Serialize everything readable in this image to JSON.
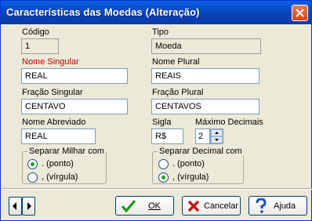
{
  "window": {
    "title": "Características das Moedas (Alteração)"
  },
  "fields": {
    "codigo": {
      "label": "Código",
      "value": "1"
    },
    "tipo": {
      "label": "Tipo",
      "value": "Moeda"
    },
    "nome_singular": {
      "label": "Nome Singular",
      "value": "REAL"
    },
    "nome_plural": {
      "label": "Nome Plural",
      "value": "REAIS"
    },
    "fracao_singular": {
      "label": "Fração Singular",
      "value": "CENTAVO"
    },
    "fracao_plural": {
      "label": "Fração Plural",
      "value": "CENTAVOS"
    },
    "nome_abreviado": {
      "label": "Nome Abreviado",
      "value": "REAL"
    },
    "sigla": {
      "label": "Sigla",
      "value": "R$"
    },
    "maximo_decimais": {
      "label": "Máximo Decimais",
      "value": "2"
    }
  },
  "separar_milhar": {
    "label": "Separar Milhar com",
    "options": [
      {
        "label": ". (ponto)",
        "selected": true
      },
      {
        "label": ", (vírgula)",
        "selected": false
      }
    ]
  },
  "separar_decimal": {
    "label": "Separar Decimal com",
    "options": [
      {
        "label": ". (ponto)",
        "selected": false
      },
      {
        "label": ", (vírgula)",
        "selected": true
      }
    ]
  },
  "buttons": {
    "ok": "OK",
    "cancelar": "Cancelar",
    "ajuda": "Ajuda"
  },
  "icons": {
    "close": "close-icon",
    "prev": "prev-arrow-icon",
    "next": "next-arrow-icon",
    "ok": "checkmark-icon",
    "cancel": "x-mark-icon",
    "help": "help-question-icon"
  }
}
